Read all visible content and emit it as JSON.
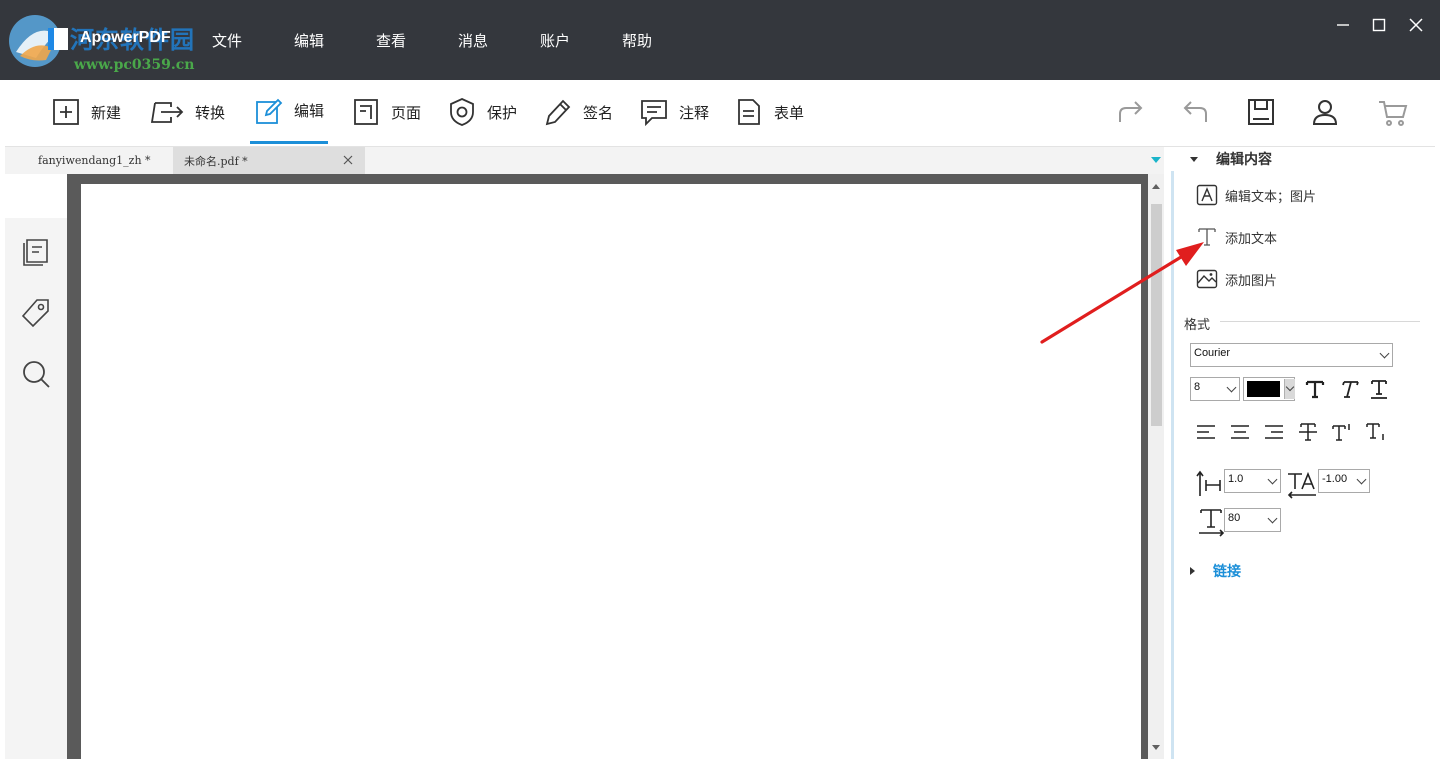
{
  "watermark": {
    "site_name": "河东软件园",
    "site_url": "www.pc0359.cn"
  },
  "app": {
    "name": "ApowerPDF",
    "accent_color": "#1c8fd8",
    "titlebar_color": "#34373d"
  },
  "menu": [
    "文件",
    "编辑",
    "查看",
    "消息",
    "账户",
    "帮助"
  ],
  "window_controls": {
    "minimize": "—",
    "maximize": "☐",
    "close": "✕"
  },
  "toolbar": {
    "tools": [
      {
        "label": "新建",
        "icon": "plus-square-icon"
      },
      {
        "label": "转换",
        "icon": "convert-icon"
      },
      {
        "label": "编辑",
        "icon": "edit-pencil-icon",
        "active": true
      },
      {
        "label": "页面",
        "icon": "page-icon"
      },
      {
        "label": "保护",
        "icon": "shield-icon"
      },
      {
        "label": "签名",
        "icon": "pen-icon"
      },
      {
        "label": "注释",
        "icon": "comment-icon"
      },
      {
        "label": "表单",
        "icon": "form-icon"
      }
    ],
    "right_icons": [
      "redo-icon",
      "undo-icon",
      "save-icon",
      "user-icon",
      "cart-icon"
    ]
  },
  "tabs": [
    {
      "title": "fanyiwendang1_zh *",
      "active": false
    },
    {
      "title": "未命名.pdf *",
      "active": true
    }
  ],
  "left_panel": {
    "icons": [
      "thumbnails-icon",
      "bookmark-tag-icon",
      "search-icon"
    ]
  },
  "right_panel": {
    "edit_content": {
      "title": "编辑内容",
      "items": [
        {
          "label": "编辑文本；图片",
          "icon": "edit-text-image-icon"
        },
        {
          "label": "添加文本",
          "icon": "add-text-icon"
        },
        {
          "label": "添加图片",
          "icon": "add-image-icon"
        }
      ]
    },
    "format": {
      "label": "格式",
      "font_family": "Courier",
      "font_size": "8",
      "color": "#000000",
      "line_spacing": "1.0",
      "char_spacing": "-1.00",
      "scale": "80"
    },
    "link": {
      "title": "链接"
    }
  }
}
